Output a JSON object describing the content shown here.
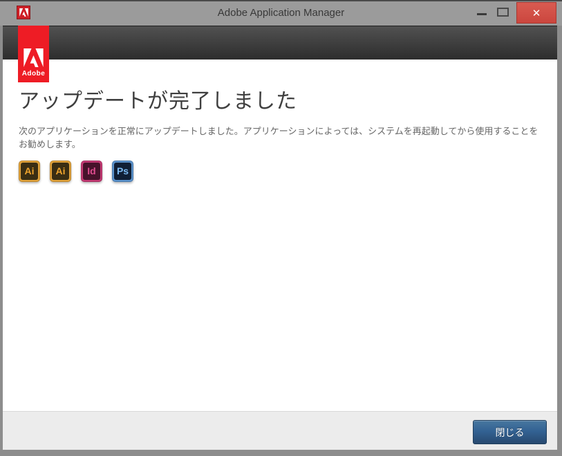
{
  "window": {
    "title": "Adobe Application Manager",
    "controls": {
      "close_glyph": "✕"
    }
  },
  "header": {
    "brand_label": "Adobe"
  },
  "main": {
    "heading": "アップデートが完了しました",
    "description": "次のアプリケーションを正常にアップデートしました。アプリケーションによっては、システムを再起動してから使用することをお勧めします。",
    "apps": [
      {
        "name": "illustrator",
        "label": "Ai",
        "frame_color": "#e2a33b",
        "bg_color": "#3a2e13",
        "letter_color": "#efa42d"
      },
      {
        "name": "illustrator",
        "label": "Ai",
        "frame_color": "#e2a33b",
        "bg_color": "#3a2e13",
        "letter_color": "#efa42d"
      },
      {
        "name": "indesign",
        "label": "Id",
        "frame_color": "#c53a74",
        "bg_color": "#47122b",
        "letter_color": "#de4c8e"
      },
      {
        "name": "photoshop",
        "label": "Ps",
        "frame_color": "#5b93cd",
        "bg_color": "#101f35",
        "letter_color": "#7cbaf2"
      }
    ]
  },
  "footer": {
    "close_label": "閉じる"
  },
  "colors": {
    "adobe_red": "#ee1c25",
    "titlebar_gray": "#9b9b9b",
    "close_button_red": "#d05048",
    "footer_gray": "#ececec",
    "primary_button_blue": "#336293"
  }
}
